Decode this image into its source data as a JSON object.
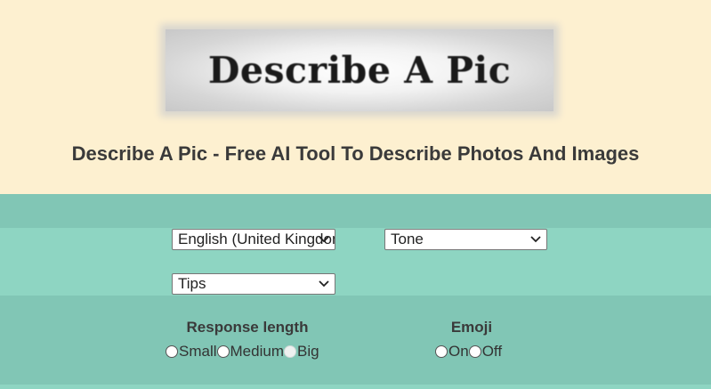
{
  "header": {
    "logo_text": "Describe A Pic",
    "title": "Describe A Pic - Free AI Tool To Describe Photos And Images"
  },
  "form": {
    "language": {
      "selected": "English (United Kingdom)"
    },
    "tone": {
      "selected": "Tone"
    },
    "tips": {
      "selected": "Tips"
    },
    "response_length": {
      "label": "Response length",
      "options": [
        "Small",
        "Medium",
        "Big"
      ]
    },
    "emoji": {
      "label": "Emoji",
      "options": [
        "On",
        "Off"
      ]
    }
  },
  "colors": {
    "header_bg": "#fdf0d0",
    "band_dark": "#81c6b5",
    "band_light": "#8ed5c2"
  }
}
